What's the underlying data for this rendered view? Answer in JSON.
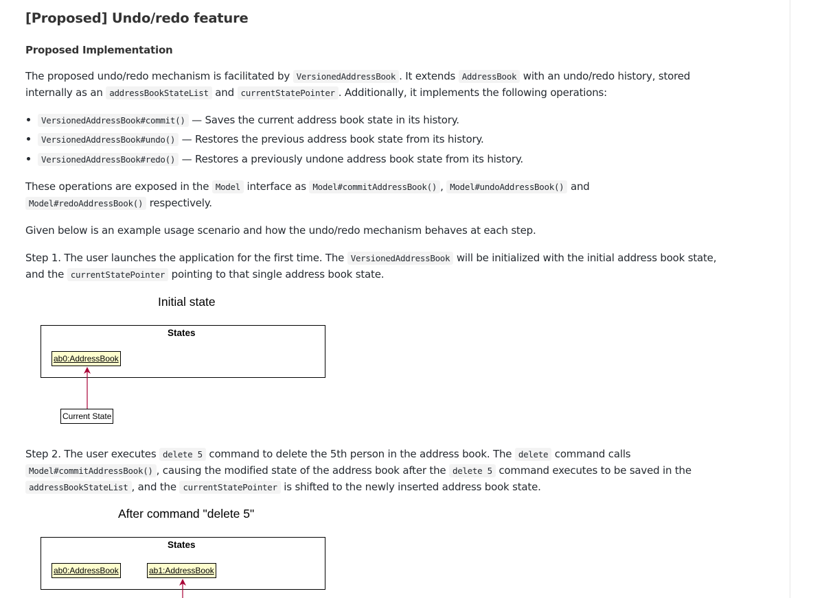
{
  "title": "[Proposed] Undo/redo feature",
  "subtitle": "Proposed Implementation",
  "para1": {
    "t1": "The proposed undo/redo mechanism is facilitated by ",
    "c1": "VersionedAddressBook",
    "t2": ". It extends ",
    "c2": "AddressBook",
    "t3": " with an undo/redo history, stored",
    "t4": "internally as an ",
    "c3": "addressBookStateList",
    "t5": " and ",
    "c4": "currentStatePointer",
    "t6": ". Additionally, it implements the following operations:"
  },
  "bullets": [
    {
      "code": "VersionedAddressBook#commit()",
      "text": " — Saves the current address book state in its history."
    },
    {
      "code": "VersionedAddressBook#undo()",
      "text": " — Restores the previous address book state from its history."
    },
    {
      "code": "VersionedAddressBook#redo()",
      "text": " — Restores a previously undone address book state from its history."
    }
  ],
  "para2": {
    "t1": "These operations are exposed in the ",
    "c1": "Model",
    "t2": " interface as ",
    "c2": "Model#commitAddressBook()",
    "t3": ", ",
    "c3": "Model#undoAddressBook()",
    "t4": " and",
    "c4": "Model#redoAddressBook()",
    "t5": " respectively."
  },
  "para3": "Given below is an example usage scenario and how the undo/redo mechanism behaves at each step.",
  "step1": {
    "t1": "Step 1. The user launches the application for the first time. The ",
    "c1": "VersionedAddressBook",
    "t2": " will be initialized with the initial address book state,",
    "t3": "and the ",
    "c2": "currentStatePointer",
    "t4": " pointing to that single address book state."
  },
  "diagram1": {
    "title": "Initial state",
    "frame_label": "States",
    "objects": [
      "ab0:AddressBook"
    ],
    "pointer": "Current State"
  },
  "step2": {
    "t1": "Step 2. The user executes ",
    "c1": "delete 5",
    "t2": " command to delete the 5th person in the address book. The ",
    "c2": "delete",
    "t3": " command calls",
    "c3": "Model#commitAddressBook()",
    "t4": ", causing the modified state of the address book after the ",
    "c4": "delete 5",
    "t5": " command executes to be saved in the",
    "c5": "addressBookStateList",
    "t6": ", and the ",
    "c6": "currentStatePointer",
    "t7": " is shifted to the newly inserted address book state."
  },
  "diagram2": {
    "title": "After command \"delete 5\"",
    "frame_label": "States",
    "objects": [
      "ab0:AddressBook",
      "ab1:AddressBook"
    ]
  },
  "colors": {
    "arrow": "#a80036",
    "object_fill": "#fefece",
    "code_bg": "#f3f3f3"
  }
}
